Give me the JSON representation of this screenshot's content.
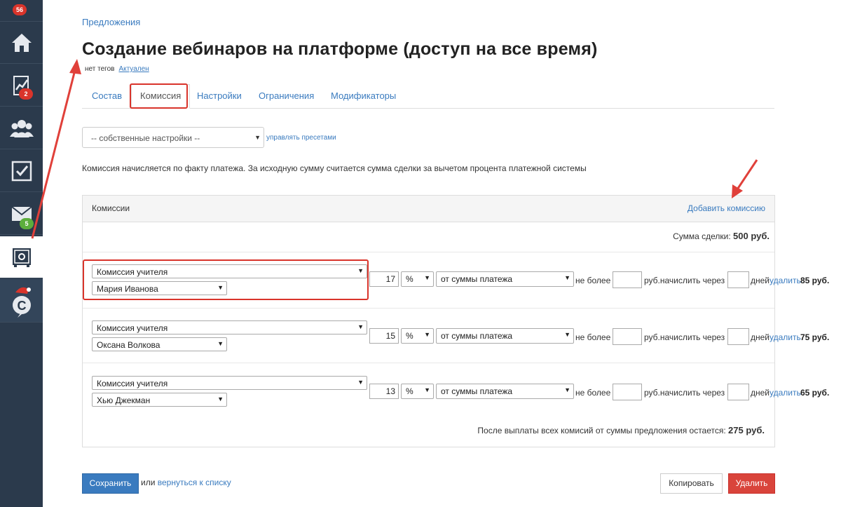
{
  "sidebar": {
    "badges": {
      "top": "56",
      "stats": "2",
      "mail": "5"
    },
    "items": [
      {
        "icon": "home-icon"
      },
      {
        "icon": "chart-icon"
      },
      {
        "icon": "users-icon"
      },
      {
        "icon": "checkbox-icon"
      },
      {
        "icon": "mail-icon"
      },
      {
        "icon": "safe-icon"
      },
      {
        "icon": "logo-icon"
      }
    ]
  },
  "breadcrumb": "Предложения",
  "page_title": "Создание вебинаров на платформе (доступ на все время)",
  "tags": {
    "none": "нет тегов",
    "status": "Актуален"
  },
  "tabs": [
    "Состав",
    "Комиссия",
    "Настройки",
    "Ограничения",
    "Модификаторы"
  ],
  "preset": {
    "selected": "-- собственные настройки --",
    "manage_link": "управлять пресетами"
  },
  "note": "Комиссия начисляется по факту платежа. За исходную сумму считается сумма сделки за вычетом процента платежной системы",
  "panel": {
    "title": "Комиссии",
    "add_link": "Добавить комиссию",
    "deal_sum_label": "Сумма сделки:",
    "deal_sum_value": "500 руб.",
    "labels": {
      "no_more": "не более",
      "rub_accrue": "руб.начислить через",
      "days": "дней",
      "delete": "удалить"
    },
    "rows": [
      {
        "type": "Комиссия учителя",
        "person": "Мария Иванова",
        "value": "17",
        "unit": "%",
        "basis": "от суммы платежа",
        "amount": "85 руб."
      },
      {
        "type": "Комиссия учителя",
        "person": "Оксана Волкова",
        "value": "15",
        "unit": "%",
        "basis": "от суммы платежа",
        "amount": "75 руб."
      },
      {
        "type": "Комиссия учителя",
        "person": "Хью Джекман",
        "value": "13",
        "unit": "%",
        "basis": "от суммы платежа",
        "amount": "65 руб."
      }
    ],
    "remain_label": "После выплаты всех комисий от суммы предложения остается:",
    "remain_value": "275 руб."
  },
  "footer": {
    "save": "Сохранить",
    "or": "или",
    "back_link": "вернуться к списку",
    "copy": "Копировать",
    "delete": "Удалить"
  },
  "colors": {
    "accent": "#3a7bbf",
    "danger": "#d9342b",
    "sidebar": "#2b3a4c"
  }
}
